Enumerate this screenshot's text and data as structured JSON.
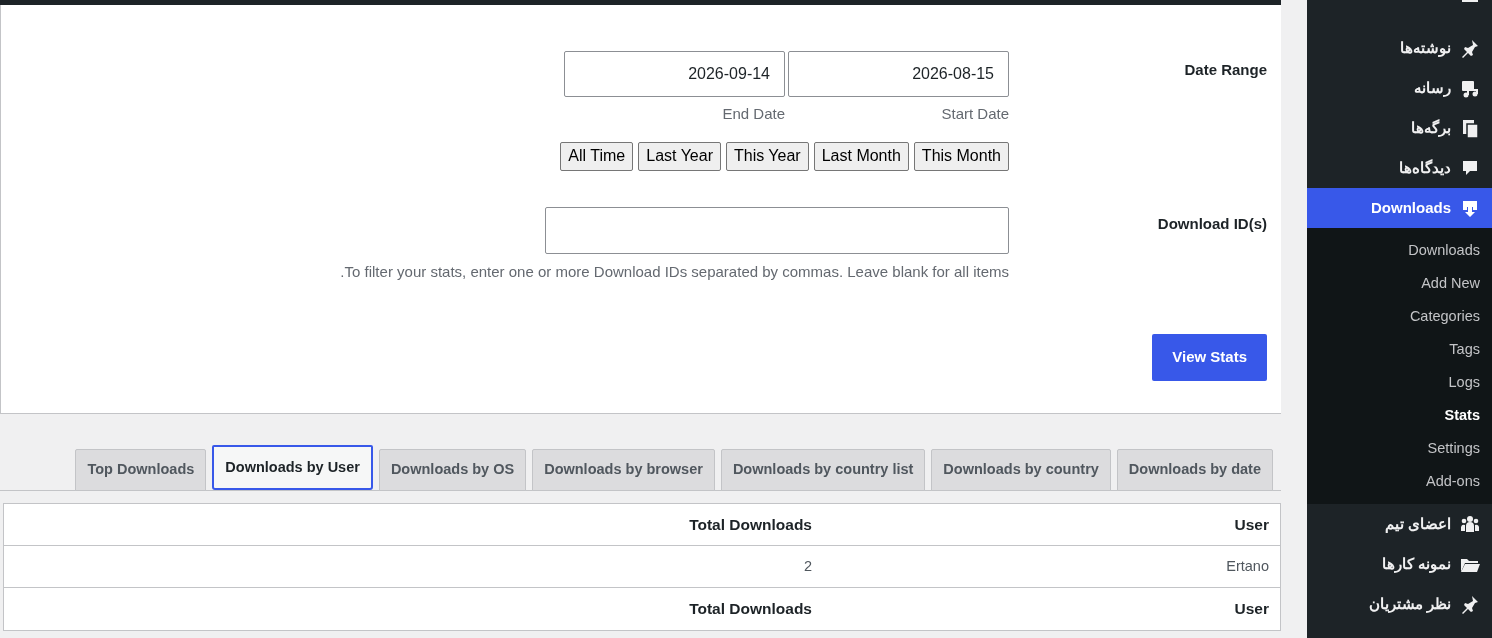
{
  "form": {
    "date_range": {
      "label": "Date Range",
      "start": {
        "value": "2026-08-15",
        "caption": "Start Date"
      },
      "end": {
        "value": "2026-09-14",
        "caption": "End Date"
      },
      "presets": [
        "All Time",
        "Last Year",
        "This Year",
        "Last Month",
        "This Month"
      ]
    },
    "download_ids": {
      "label": "Download ID(s)",
      "help": "To filter your stats, enter one or more Download IDs separated by commas. Leave blank for all items."
    },
    "submit": "View Stats"
  },
  "tabs": [
    {
      "label": "Top Downloads",
      "selected": false
    },
    {
      "label": "Downloads by User",
      "selected": true
    },
    {
      "label": "Downloads by OS",
      "selected": false
    },
    {
      "label": "Downloads by browser",
      "selected": false
    },
    {
      "label": "Downloads by country list",
      "selected": false
    },
    {
      "label": "Downloads by country",
      "selected": false
    },
    {
      "label": "Downloads by date",
      "selected": false
    }
  ],
  "table": {
    "columns": [
      "Total Downloads",
      "User"
    ],
    "rows": [
      [
        "2",
        "Ertano"
      ]
    ],
    "footer": [
      "Total Downloads",
      "User"
    ]
  },
  "sidebar": {
    "items": [
      {
        "label": "نوشته‌ها",
        "selected": false
      },
      {
        "label": "رسانه",
        "selected": false
      },
      {
        "label": "برگه‌ها",
        "selected": false
      },
      {
        "label": "دیدگاه‌ها",
        "selected": false
      },
      {
        "label": "Downloads",
        "selected": true,
        "children": [
          {
            "label": "Downloads",
            "selected": false
          },
          {
            "label": "Add New",
            "selected": false
          },
          {
            "label": "Categories",
            "selected": false
          },
          {
            "label": "Tags",
            "selected": false
          },
          {
            "label": "Logs",
            "selected": false
          },
          {
            "label": "Stats",
            "selected": true
          },
          {
            "label": "Settings",
            "selected": false
          },
          {
            "label": "Add-ons",
            "selected": false
          }
        ]
      },
      {
        "label": "اعضای تیم",
        "selected": false
      },
      {
        "label": "نمونه کارها",
        "selected": false
      },
      {
        "label": "نظر مشتریان",
        "selected": false
      }
    ]
  }
}
